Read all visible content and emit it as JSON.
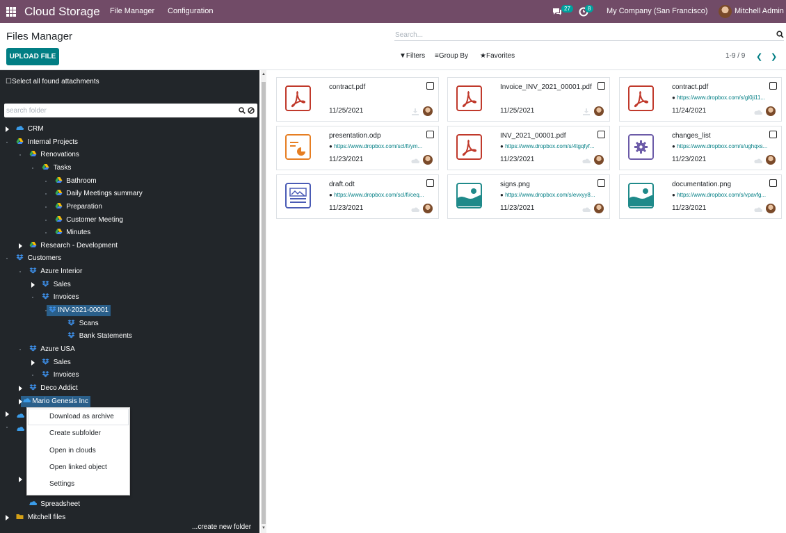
{
  "topbar": {
    "brand": "Cloud Storage",
    "menu": [
      "File Manager",
      "Configuration"
    ],
    "messages_count": "27",
    "activities_count": "8",
    "company": "My Company (San Francisco)",
    "user": "Mitchell Admin",
    "bg_color": "#714B67"
  },
  "control_panel": {
    "title": "Files Manager",
    "upload_label": "UPLOAD FILE",
    "search_placeholder": "Search...",
    "filters_label": "Filters",
    "groupby_label": "Group By",
    "favorites_label": "Favorites",
    "pager": "1-9 / 9"
  },
  "sidebar": {
    "select_all": "Select all found attachments",
    "search_placeholder": "search folder",
    "create_folder": "...create new folder",
    "tree": [
      {
        "label": "CRM",
        "icon": "onedrive-icon",
        "level": 0
      },
      {
        "label": "Internal Projects",
        "icon": "google-drive-icon",
        "level": 0
      },
      {
        "label": "Renovations",
        "icon": "google-drive-icon",
        "level": 1
      },
      {
        "label": "Tasks",
        "icon": "google-drive-icon",
        "level": 2
      },
      {
        "label": "Bathroom",
        "icon": "google-drive-icon",
        "level": 3
      },
      {
        "label": "Daily Meetings summary",
        "icon": "google-drive-icon",
        "level": 3
      },
      {
        "label": "Preparation",
        "icon": "google-drive-icon",
        "level": 3
      },
      {
        "label": "Customer Meeting",
        "icon": "google-drive-icon",
        "level": 3
      },
      {
        "label": "Minutes",
        "icon": "google-drive-icon",
        "level": 3
      },
      {
        "label": "Research - Development",
        "icon": "google-drive-icon",
        "level": 1
      },
      {
        "label": "Customers",
        "icon": "dropbox-icon",
        "level": 0
      },
      {
        "label": "Azure Interior",
        "icon": "dropbox-icon",
        "level": 1
      },
      {
        "label": "Sales",
        "icon": "dropbox-icon",
        "level": 2
      },
      {
        "label": "Invoices",
        "icon": "dropbox-icon",
        "level": 2
      },
      {
        "label": "INV-2021-00001",
        "icon": "dropbox-icon",
        "level": 3
      },
      {
        "label": "Scans",
        "icon": "dropbox-icon",
        "level": 4
      },
      {
        "label": "Bank Statements",
        "icon": "dropbox-icon",
        "level": 4
      },
      {
        "label": "Azure USA",
        "icon": "dropbox-icon",
        "level": 1
      },
      {
        "label": "Sales",
        "icon": "dropbox-icon",
        "level": 2
      },
      {
        "label": "Invoices",
        "icon": "dropbox-icon",
        "level": 2
      },
      {
        "label": "Deco Addict",
        "icon": "dropbox-icon",
        "level": 1
      },
      {
        "label": "Mario Genesis Inc",
        "icon": "onedrive-icon",
        "level": 1
      },
      {
        "label": "Spreadsheet",
        "icon": "onedrive-icon",
        "level": 1
      },
      {
        "label": "Mitchell files",
        "icon": "folder-icon",
        "level": 0
      }
    ]
  },
  "context_menu": [
    "Download as archive",
    "Create subfolder",
    "Open in clouds",
    "Open linked object",
    "Settings"
  ],
  "files": [
    {
      "name": "contract.pdf",
      "url": "",
      "date": "11/25/2021",
      "type": "pdf",
      "status": "download-icon"
    },
    {
      "name": "Invoice_INV_2021_00001.pdf",
      "url": "",
      "date": "11/25/2021",
      "type": "pdf",
      "status": "download-icon"
    },
    {
      "name": "contract.pdf",
      "url": "https://www.dropbox.com/s/gl0ji11...",
      "date": "11/24/2021",
      "type": "pdf",
      "status": "cloud-icon"
    },
    {
      "name": "presentation.odp",
      "url": "https://www.dropbox.com/scl/fi/ym...",
      "date": "11/23/2021",
      "type": "presentation",
      "status": "cloud-icon"
    },
    {
      "name": "INV_2021_00001.pdf",
      "url": "https://www.dropbox.com/s/4tgqfyf...",
      "date": "11/23/2021",
      "type": "pdf",
      "status": "cloud-icon"
    },
    {
      "name": "changes_list",
      "url": "https://www.dropbox.com/s/ughqxs...",
      "date": "11/23/2021",
      "type": "binary",
      "status": "cloud-icon"
    },
    {
      "name": "draft.odt",
      "url": "https://www.dropbox.com/scl/fi/ceq...",
      "date": "11/23/2021",
      "type": "document",
      "status": "cloud-icon"
    },
    {
      "name": "signs.png",
      "url": "https://www.dropbox.com/s/evxyy8...",
      "date": "11/23/2021",
      "type": "image",
      "status": "cloud-icon"
    },
    {
      "name": "documentation.png",
      "url": "https://www.dropbox.com/s/vpavfg...",
      "date": "11/23/2021",
      "type": "image",
      "status": "cloud-icon"
    }
  ]
}
